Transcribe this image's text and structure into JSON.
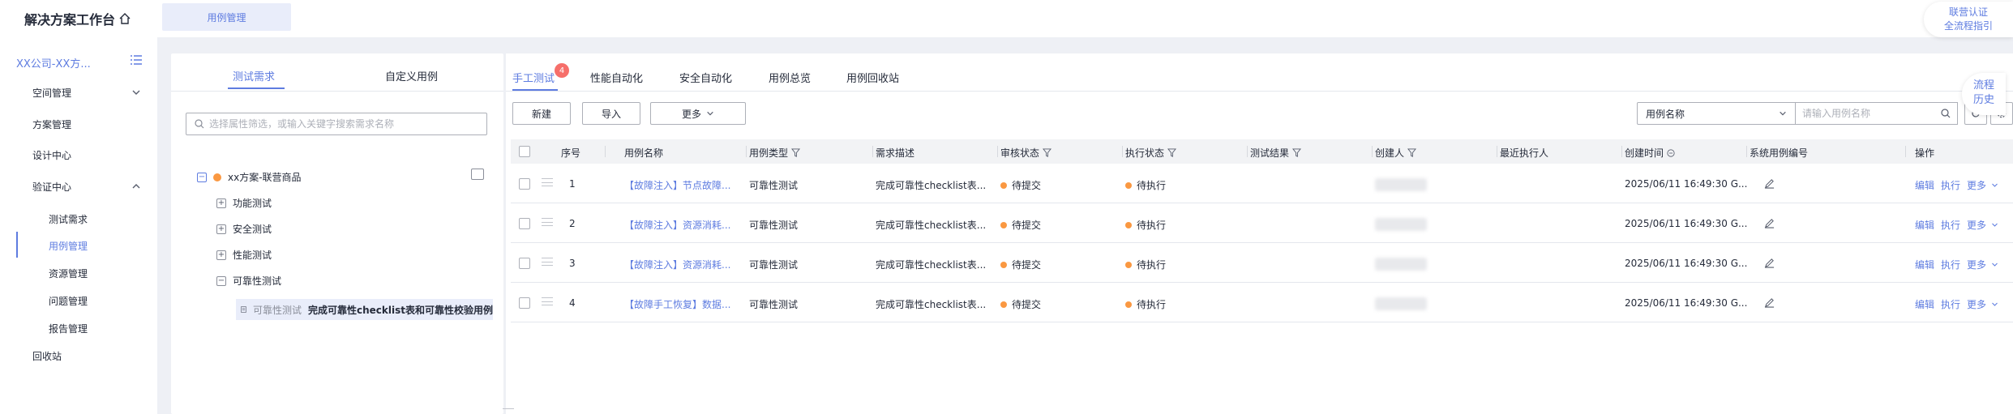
{
  "app": {
    "title": "解决方案工作台"
  },
  "sidebar": {
    "company": "XX公司-XX方...",
    "items": [
      {
        "label": "空间管理"
      },
      {
        "label": "方案管理"
      },
      {
        "label": "设计中心"
      },
      {
        "label": "验证中心"
      },
      {
        "label": "回收站"
      }
    ],
    "sub_items": [
      {
        "label": "测试需求"
      },
      {
        "label": "用例管理"
      },
      {
        "label": "资源管理"
      },
      {
        "label": "问题管理"
      },
      {
        "label": "报告管理"
      }
    ]
  },
  "header": {
    "open_tab": "用例管理",
    "auth_line1": "联营认证",
    "auth_line2": "全流程指引"
  },
  "tree": {
    "tabs": [
      "测试需求",
      "自定义用例"
    ],
    "search_placeholder": "选择属性筛选，或输入关键字搜索需求名称",
    "root": "xx方案-联营商品",
    "children": [
      "功能测试",
      "安全测试",
      "性能测试",
      "可靠性测试"
    ],
    "selected": {
      "category": "可靠性测试",
      "title": "完成可靠性checklist表和可靠性校验用例"
    }
  },
  "main": {
    "tabs": [
      "手工测试",
      "性能自动化",
      "安全自动化",
      "用例总览",
      "用例回收站"
    ],
    "badge": "4",
    "buttons": {
      "new": "新建",
      "import": "导入",
      "more": "更多"
    },
    "select_value": "用例名称",
    "search_placeholder": "请输入用例名称",
    "columns": [
      "序号",
      "用例名称",
      "用例类型",
      "需求描述",
      "审核状态",
      "执行状态",
      "测试结果",
      "创建人",
      "最近执行人",
      "创建时间",
      "系统用例编号",
      "操作"
    ],
    "rows": [
      {
        "no": "1",
        "name": "【故障注入】节点故障...",
        "type": "可靠性测试",
        "desc": "完成可靠性checklist表...",
        "review": "待提交",
        "exec": "待执行",
        "created": "2025/06/11 16:49:30 G..."
      },
      {
        "no": "2",
        "name": "【故障注入】资源消耗...",
        "type": "可靠性测试",
        "desc": "完成可靠性checklist表...",
        "review": "待提交",
        "exec": "待执行",
        "created": "2025/06/11 16:49:30 G..."
      },
      {
        "no": "3",
        "name": "【故障注入】资源消耗...",
        "type": "可靠性测试",
        "desc": "完成可靠性checklist表...",
        "review": "待提交",
        "exec": "待执行",
        "created": "2025/06/11 16:49:30 G..."
      },
      {
        "no": "4",
        "name": "【故障手工恢复】数据...",
        "type": "可靠性测试",
        "desc": "完成可靠性checklist表...",
        "review": "待提交",
        "exec": "待执行",
        "created": "2025/06/11 16:49:30 G..."
      }
    ],
    "ops": {
      "edit": "编辑",
      "run": "执行",
      "more": "更多"
    }
  },
  "float": {
    "line1": "流程",
    "line2": "历史"
  },
  "colors": {
    "accent": "#5e7ce0",
    "pending": "#fa9841",
    "badge": "#f66f6a"
  }
}
